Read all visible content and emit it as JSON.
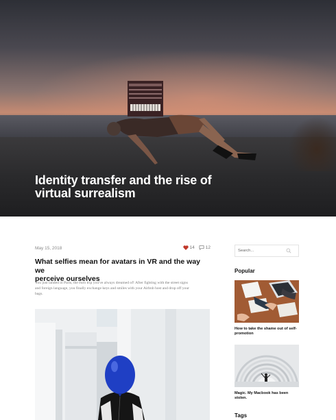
{
  "hero": {
    "title_line1": "Identity transfer and the rise of",
    "title_line2": "virtual surrealism"
  },
  "post": {
    "date": "May 15, 2018",
    "likes": "14",
    "comments": "12",
    "title_line1": "What selfies mean for avatars in VR and the way we",
    "title_line2": "perceive ourselves",
    "excerpt_line1": "You just landed in Paris, the euro trip you've always dreamed of! After fighting with the street signs",
    "excerpt_line2": "and foreign language, you finally exchange keys and smiles with your Airbnb host and drop off your",
    "excerpt_line3": "bags."
  },
  "sidebar": {
    "search_placeholder": "Search...",
    "popular_heading": "Popular",
    "popular": [
      {
        "caption_line1": "How to take the shame out of self-",
        "caption_line2": "promotion"
      },
      {
        "caption_line1": "Magic. My Macbook has been stolen.",
        "caption_line2": ""
      }
    ],
    "tags_heading": "Tags"
  },
  "colors": {
    "heart": "#c0392b",
    "text_dark": "#111111",
    "text_muted": "#888888",
    "balloon": "#1f3fc4"
  }
}
